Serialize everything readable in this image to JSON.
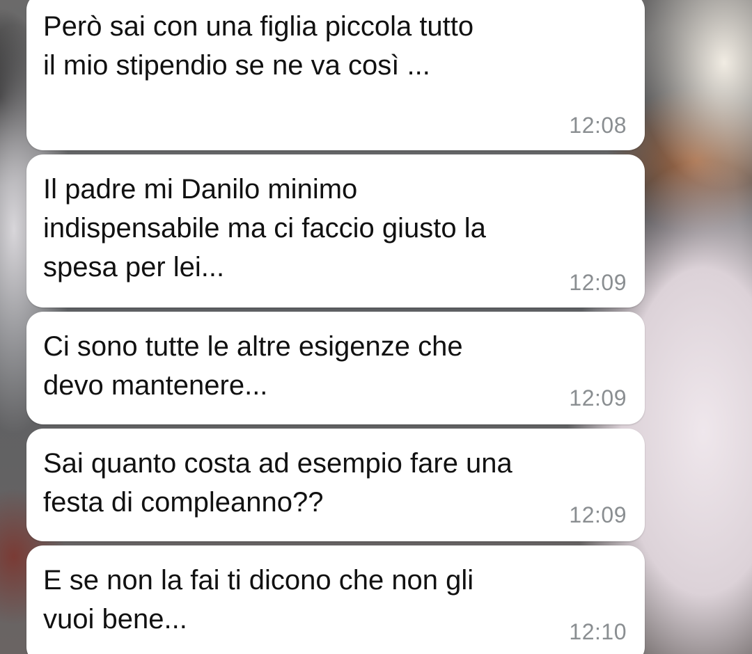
{
  "conversation": {
    "messages": [
      {
        "text": "Però sai con una figlia piccola tutto\nil mio stipendio se ne va così ...",
        "time": "12:08"
      },
      {
        "text": "Il padre mi Danilo minimo\nindispensabile ma ci faccio giusto la\nspesa per lei...",
        "time": "12:09"
      },
      {
        "text": "Ci sono tutte le altre esigenze che\ndevo mantenere...",
        "time": "12:09"
      },
      {
        "text": "Sai quanto costa ad esempio fare una\nfesta di compleanno??",
        "time": "12:09"
      },
      {
        "text": "E se non la fai ti dicono che non gli\nvuoi bene...",
        "time": "12:10"
      }
    ]
  },
  "colors": {
    "bubble_background": "#ffffff",
    "message_text": "#111111",
    "timestamp_text": "#8a8e91"
  }
}
